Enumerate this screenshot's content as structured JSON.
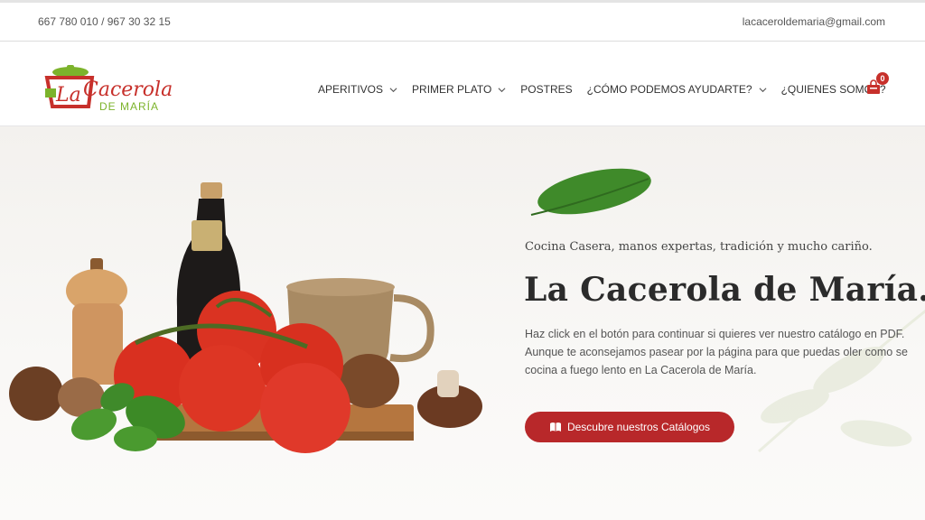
{
  "topbar": {
    "phone": "667 780 010 / 967 30 32 15",
    "email": "lacaceroldemaria@gmail.com"
  },
  "logo": {
    "line1": "Cacerola",
    "prefix": "La",
    "line2": "DE MARÍA"
  },
  "nav": {
    "items": [
      {
        "label": "APERITIVOS",
        "dropdown": true
      },
      {
        "label": "PRIMER PLATO",
        "dropdown": true
      },
      {
        "label": "POSTRES",
        "dropdown": false
      },
      {
        "label": "¿CÓMO PODEMOS AYUDARTE?",
        "dropdown": true
      },
      {
        "label": "¿QUIENES SOMOS?",
        "dropdown": false
      }
    ],
    "cart_count": "0",
    "cart_icon": "shopping-bag-icon"
  },
  "hero": {
    "tagline": "Cocina Casera, manos expertas, tradición y mucho cariño.",
    "title": "La Cacerola de María.",
    "description": "Haz click en el botón para continuar si quieres ver nuestro catálogo en PDF. Aunque te aconsejamos pasear por la página para que puedas oler como se cocina a fuego lento en La Cacerola de María.",
    "cta_label": "Descubre nuestros Catálogos",
    "cta_icon": "book-icon"
  },
  "colors": {
    "accent": "#b8282a",
    "logo_red": "#c7302b",
    "logo_green": "#7cb32b"
  }
}
